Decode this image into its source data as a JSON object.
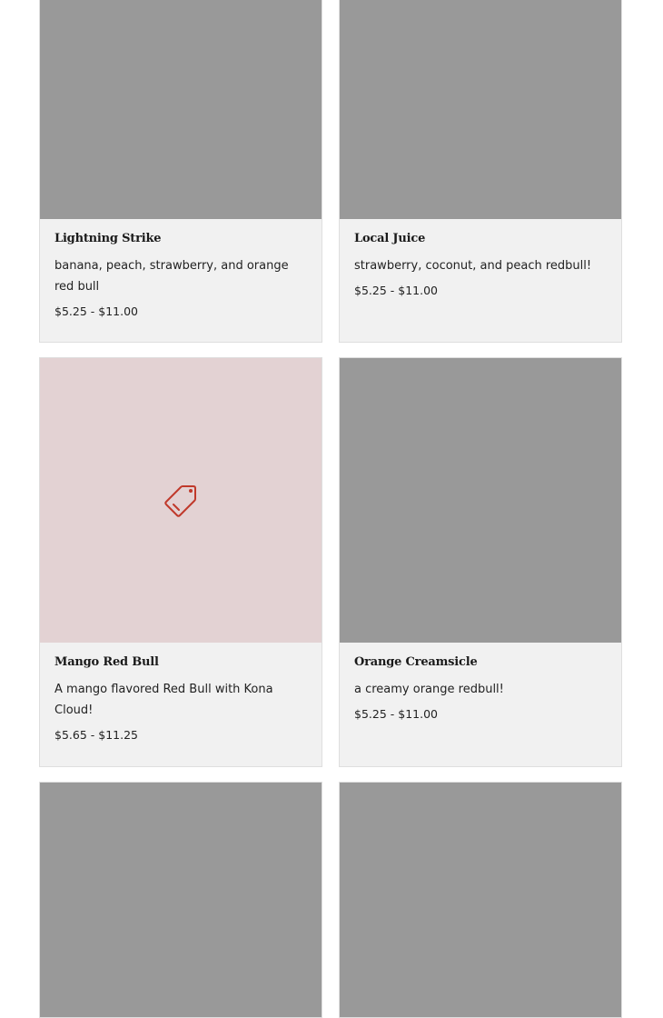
{
  "products": [
    {
      "title": "Lightning Strike",
      "description": "banana, peach, strawberry, and orange red bull",
      "price": "$5.25 - $11.00"
    },
    {
      "title": "Local Juice",
      "description": "strawberry, coconut, and peach redbull!",
      "price": "$5.25 - $11.00"
    },
    {
      "title": "Mango Red Bull",
      "description": "A mango flavored Red Bull with Kona Cloud!",
      "price": "$5.65 - $11.25",
      "image_placeholder_icon": "tag-icon"
    },
    {
      "title": "Orange Creamsicle",
      "description": "a creamy orange redbull!",
      "price": "$5.25 - $11.00"
    }
  ],
  "colors": {
    "image_placeholder": "#999999",
    "placeholder_bg": "#e3d2d3",
    "tag_icon": "#c0392b",
    "card_bg": "#f1f1f1"
  }
}
